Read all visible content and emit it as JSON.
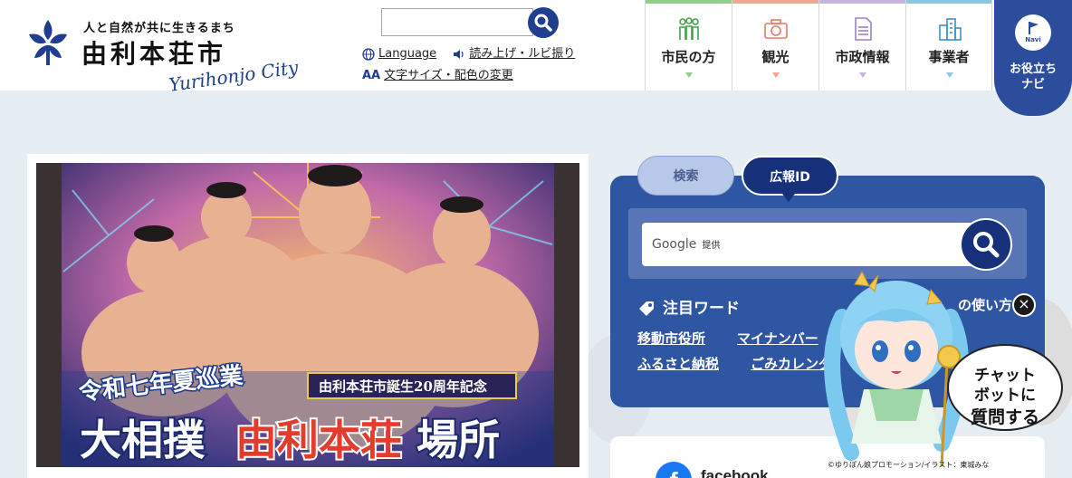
{
  "header": {
    "tagline": "人と自然が共に生きるまち",
    "city_jp": "由利本荘市",
    "city_en": "Yurihonjo City",
    "search": {
      "value": "",
      "placeholder": ""
    },
    "util": {
      "language": "Language",
      "read_aloud": "読み上げ・ルビ振り",
      "text_size": "文字サイズ・配色の変更",
      "aa": "AA"
    },
    "nav": [
      {
        "label": "市民の方",
        "color": "#8fcf8a",
        "icon": "people-icon"
      },
      {
        "label": "観光",
        "color": "#f2a693",
        "icon": "camera-icon"
      },
      {
        "label": "市政情報",
        "color": "#c6b4dc",
        "icon": "document-icon"
      },
      {
        "label": "事業者",
        "color": "#8ec6e6",
        "icon": "building-icon"
      }
    ],
    "navi": {
      "badge": "Navi",
      "line1": "お役立ち",
      "line2": "ナビ"
    }
  },
  "banner": {
    "line_top": "令和七年夏巡業",
    "ribbon": "由利本荘市誕生20周年記念",
    "line_main_1": "大相撲",
    "line_main_2": "由利本荘",
    "line_main_3": "場所"
  },
  "search_panel": {
    "tab_search": "検索",
    "tab_koho": "広報ID",
    "google_label": "Google",
    "google_sub": "提供",
    "keywords_title": "注目ワード",
    "howto": "の使い方",
    "keywords": [
      "移動市役所",
      "マイナンバー",
      "ふるさと納税",
      "ごみカレンダ"
    ]
  },
  "chatbot": {
    "line1": "チャット",
    "line2": "ボットに",
    "line3": "質問する",
    "close": "×",
    "credit": "©ゆりぽん娘プロモーション/イラスト：東城みな"
  },
  "facebook": {
    "label": "facebook"
  },
  "colors": {
    "brand_blue": "#1f3f8e",
    "panel_blue": "#2f56a3",
    "dark_blue": "#16307a",
    "page_bg": "#e6eef4"
  }
}
